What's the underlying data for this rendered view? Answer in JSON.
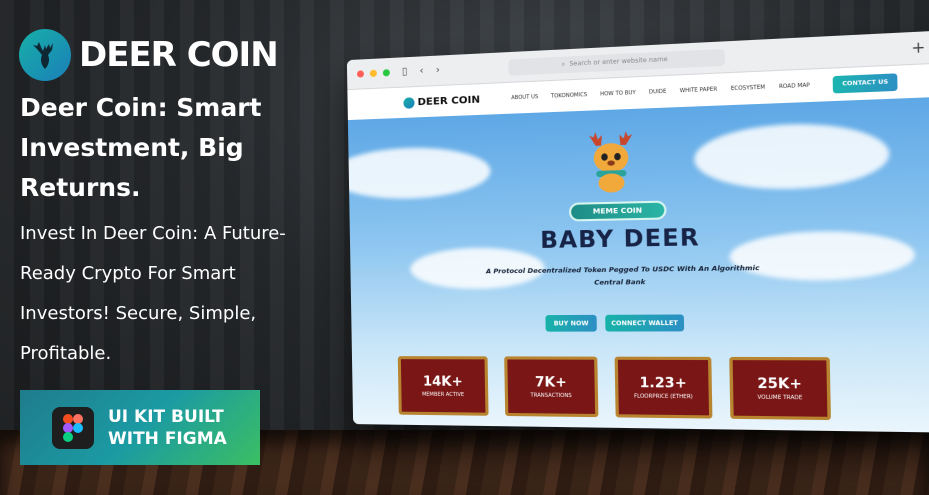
{
  "brand": {
    "name": "DEER COIN"
  },
  "headline": "Deer Coin: Smart Investment, Big Returns.",
  "subline": "Invest In Deer Coin: A Future-Ready Crypto For Smart Investors! Secure, Simple, Profitable.",
  "badge": {
    "line1": "UI KIT BUILT",
    "line2": "WITH FIGMA"
  },
  "browser": {
    "url_placeholder": "Search or enter website name",
    "site": {
      "logo": "DEER COIN",
      "nav": [
        "ABOUT US",
        "TOKONOMICS",
        "HOW TO BUY",
        "DUIDE",
        "WHITE PAPER",
        "ECOSYSTEM",
        "ROAD MAP"
      ],
      "contact": "CONTACT US"
    },
    "hero": {
      "pill": "MEME COIN",
      "title": "BABY DEER",
      "tagline": "A Protocol Decentralized Token Pegged To USDC With An Algorithmic Central Bank",
      "buy_now": "BUY NOW",
      "connect_wallet": "CONNECT WALLET"
    },
    "stats": [
      {
        "value": "14K+",
        "label": "MEMBER ACTIVE"
      },
      {
        "value": "7K+",
        "label": "TRANSACTIONS"
      },
      {
        "value": "1.23+",
        "label": "FLOORPRICE (ETHER)"
      },
      {
        "value": "25K+",
        "label": "VOLUME TRADE"
      }
    ]
  },
  "colors": {
    "accent": "#1bb5b0",
    "card": "#7a1616",
    "card_border": "#b8842f",
    "title": "#172447"
  }
}
